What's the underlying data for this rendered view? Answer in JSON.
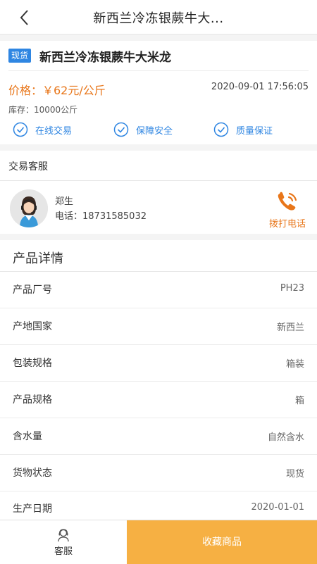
{
  "header": {
    "title": "新西兰冷冻银蕨牛大...",
    "back_icon": "chevron-left-icon"
  },
  "product": {
    "badge": "现货",
    "name": "新西兰冷冻银蕨牛大米龙",
    "price": "价格：￥62元/公斤",
    "time": "2020-09-01 17:56:05",
    "stock": "库存：10000公斤",
    "features": [
      "在线交易",
      "保障安全",
      "质量保证"
    ]
  },
  "service": {
    "title": "交易客服",
    "name": "郑生",
    "phone": "电话：18731585032",
    "call_label": "拨打电话"
  },
  "details": {
    "title": "产品详情",
    "rows": [
      {
        "label": "产品厂号",
        "value": "PH23"
      },
      {
        "label": "产地国家",
        "value": "新西兰"
      },
      {
        "label": "包装规格",
        "value": "箱装"
      },
      {
        "label": "产品规格",
        "value": "箱"
      },
      {
        "label": "含水量",
        "value": "自然含水"
      },
      {
        "label": "货物状态",
        "value": "现货"
      },
      {
        "label": "生产日期",
        "value": "2020-01-01"
      }
    ]
  },
  "bottom": {
    "cs_label": "客服",
    "fav_label": "收藏商品"
  },
  "colors": {
    "accent": "#e8761a",
    "blue": "#2f86e2",
    "favorite_bg": "#f6b043"
  }
}
